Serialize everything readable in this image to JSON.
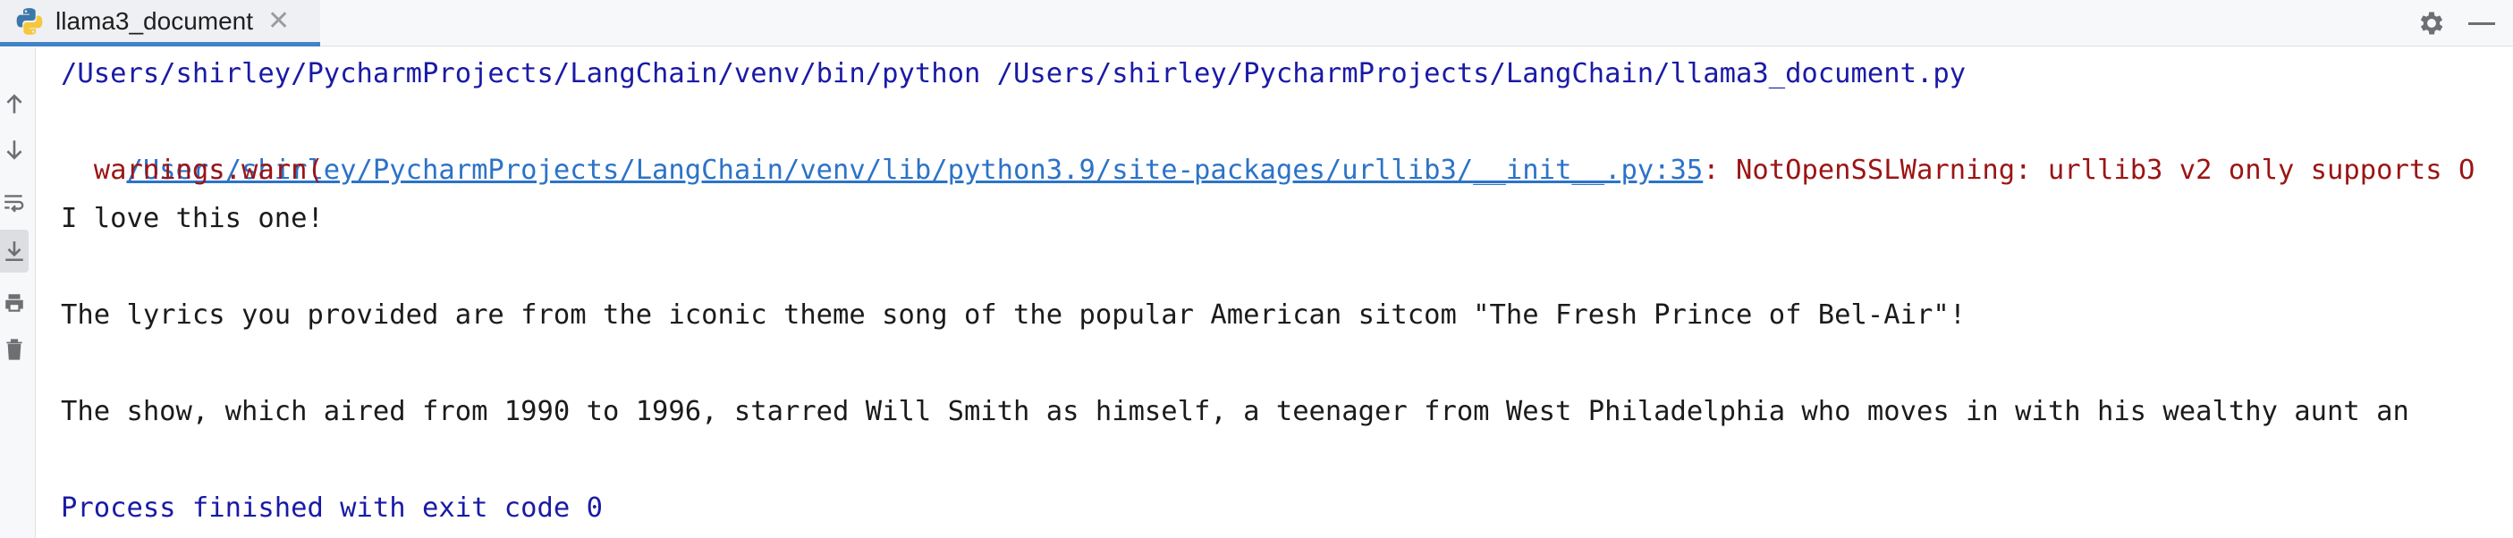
{
  "tab": {
    "title": "llama3_document",
    "icon": "python-icon",
    "close_icon": "close-icon"
  },
  "toolbar": {
    "settings_icon": "gear-icon",
    "minimize_icon": "minimize-icon"
  },
  "sidebar": {
    "items": [
      {
        "icon": "arrow-up-icon"
      },
      {
        "icon": "arrow-down-icon"
      },
      {
        "icon": "soft-wrap-icon"
      },
      {
        "icon": "scroll-to-end-icon"
      },
      {
        "icon": "print-icon"
      },
      {
        "icon": "trash-icon"
      }
    ]
  },
  "console": {
    "command": "/Users/shirley/PycharmProjects/LangChain/venv/bin/python /Users/shirley/PycharmProjects/LangChain/llama3_document.py",
    "warning_link": "/Users/shirley/PycharmProjects/LangChain/venv/lib/python3.9/site-packages/urllib3/__init__.py:35",
    "warning_message": ": NotOpenSSLWarning: urllib3 v2 only supports O",
    "warning_call": "  warnings.warn(",
    "output_1": "I love this one!",
    "output_2": "The lyrics you provided are from the iconic theme song of the popular American sitcom \"The Fresh Prince of Bel-Air\"!",
    "output_3": "The show, which aired from 1990 to 1996, starred Will Smith as himself, a teenager from West Philadelphia who moves in with his wealthy aunt an",
    "exit_message": "Process finished with exit code 0"
  }
}
